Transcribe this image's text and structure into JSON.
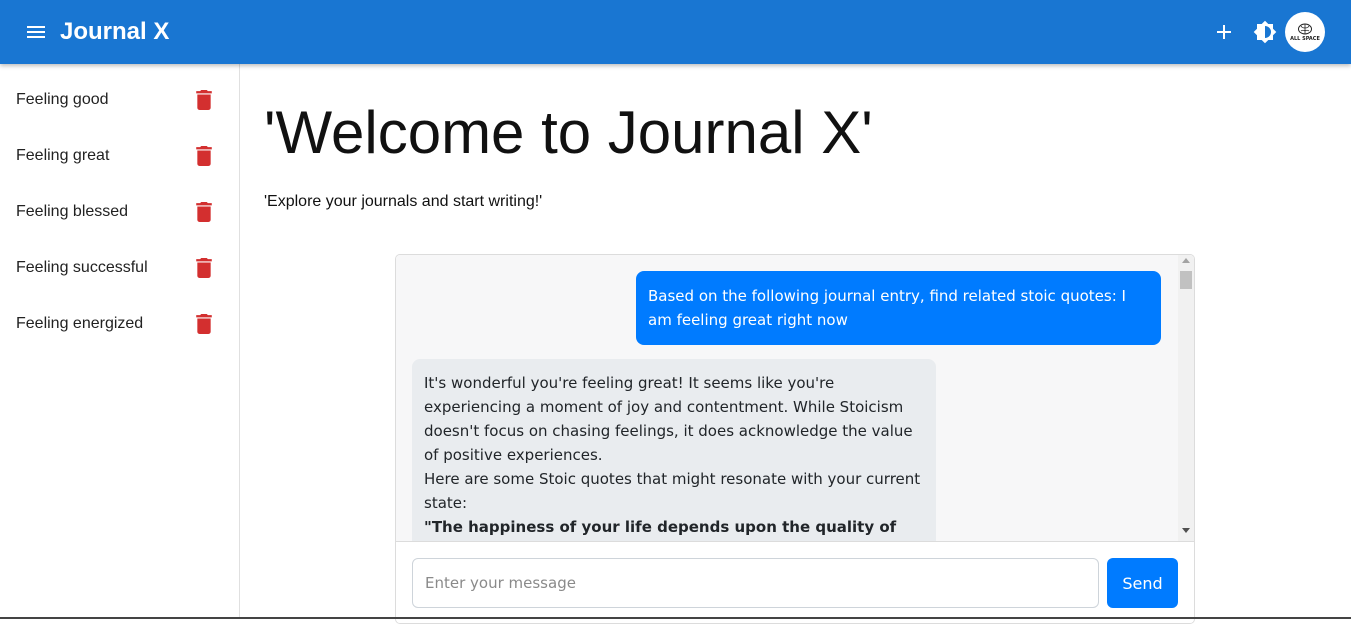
{
  "appbar": {
    "title": "Journal X",
    "avatar_text": "ALL SPACE",
    "color": "#1976d2"
  },
  "sidebar": {
    "items": [
      {
        "label": "Feeling good"
      },
      {
        "label": "Feeling great"
      },
      {
        "label": "Feeling blessed"
      },
      {
        "label": "Feeling successful"
      },
      {
        "label": "Feeling energized"
      }
    ]
  },
  "main": {
    "heading": "'Welcome to Journal X'",
    "subtitle": "'Explore your journals and start writing!'"
  },
  "chat": {
    "user_message": "Based on the following journal entry, find related stoic quotes: I am feeling great right now",
    "bot_message": {
      "line1": "It's wonderful you're feeling great! It seems like you're experiencing a moment of joy and contentment. While Stoicism doesn't focus on chasing feelings, it does acknowledge the value of positive experiences.",
      "line2": "Here are some Stoic quotes that might resonate with your current state:",
      "quote": "\"The happiness of your life depends upon the quality of your"
    },
    "input_placeholder": "Enter your message",
    "send_label": "Send",
    "accent": "#007bff"
  }
}
